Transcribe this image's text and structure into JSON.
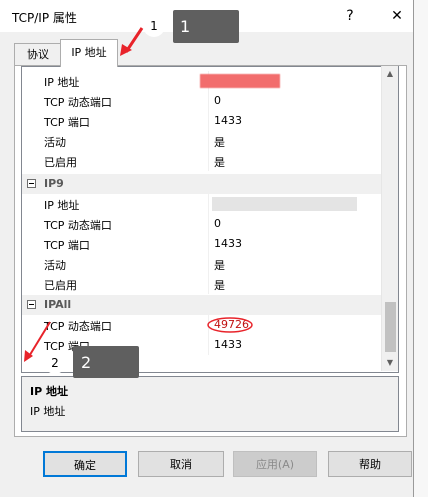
{
  "window": {
    "title": "TCP/IP 属性",
    "help_glyph": "?",
    "close_glyph": "✕"
  },
  "tabs": [
    {
      "label": "协议"
    },
    {
      "label": "IP 地址"
    }
  ],
  "grid": {
    "rows": [
      {
        "name": "IP 地址",
        "value": ""
      },
      {
        "name": "TCP 动态端口",
        "value": "0"
      },
      {
        "name": "TCP 端口",
        "value": "1433"
      },
      {
        "name": "活动",
        "value": "是"
      },
      {
        "name": "已启用",
        "value": "是"
      }
    ],
    "ip9": {
      "header": "IP9",
      "rows": [
        {
          "name": "IP 地址",
          "value": ""
        },
        {
          "name": "TCP 动态端口",
          "value": "0"
        },
        {
          "name": "TCP 端口",
          "value": "1433"
        },
        {
          "name": "活动",
          "value": "是"
        },
        {
          "name": "已启用",
          "value": "是"
        }
      ]
    },
    "ipall": {
      "header": "IPAll",
      "rows": [
        {
          "name": "TCP 动态端口",
          "value": "49726"
        },
        {
          "name": "TCP 端口",
          "value": "1433"
        }
      ]
    }
  },
  "description": {
    "title": "IP 地址",
    "text": "IP 地址"
  },
  "buttons": {
    "ok": "确定",
    "cancel": "取消",
    "apply": "应用(A)",
    "help": "帮助"
  },
  "annotations": [
    {
      "circle": "1",
      "box": "1"
    },
    {
      "circle": "2",
      "box": "2"
    }
  ],
  "colors": {
    "accent": "#0078d7",
    "annotation_red": "#e8232a",
    "callout_gray": "#5f5f5f"
  }
}
